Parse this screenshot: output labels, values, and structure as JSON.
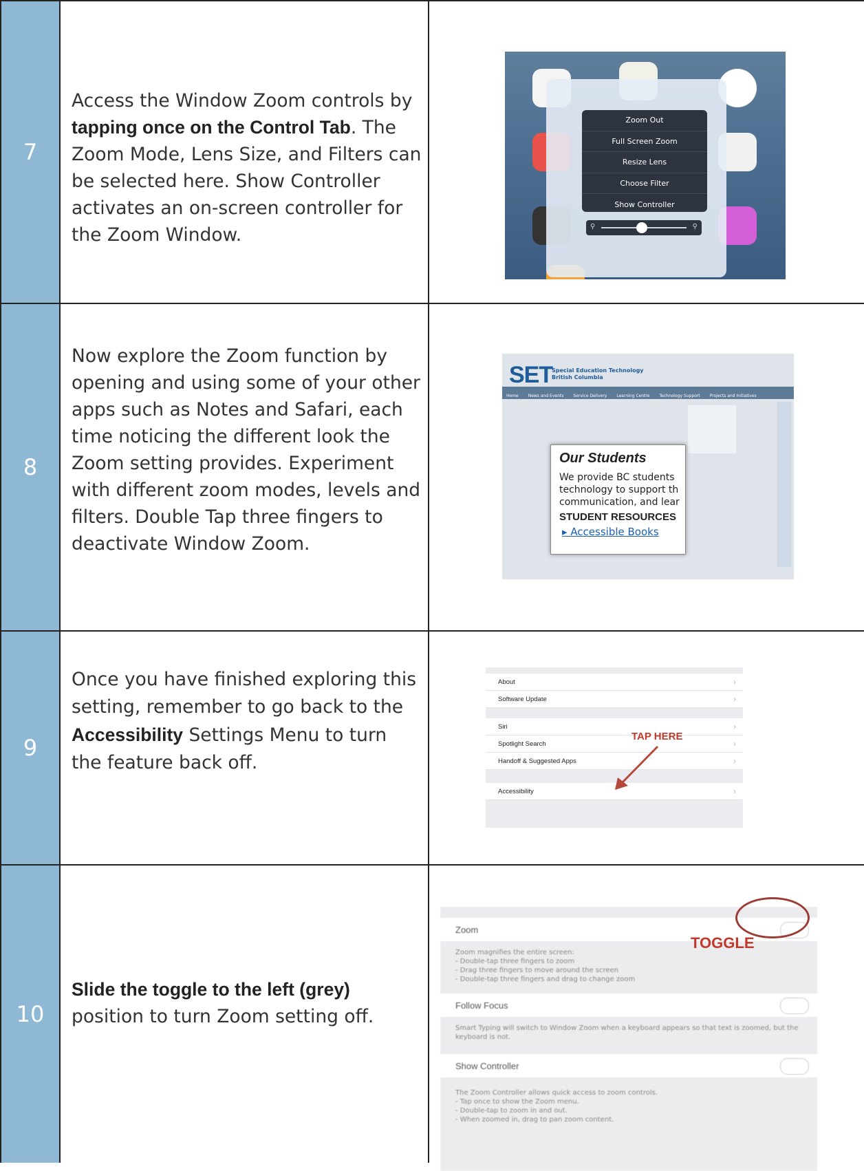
{
  "rows": [
    {
      "num": "7",
      "pre": "Access the Window Zoom controls by ",
      "bold": "tapping once on the Control Tab",
      "post": ". The Zoom Mode, Lens Size, and Filters can be selected here. Show Controller activates an on-screen controller for the Zoom Window."
    },
    {
      "num": "8",
      "text": "Now explore the Zoom function by opening and using some of your other apps such as Notes and Safari, each time noticing the different look the Zoom setting provides. Experiment with different zoom modes, levels and filters. Double Tap three fingers to deactivate Window Zoom."
    },
    {
      "num": "9",
      "pre": "Once you have finished exploring this setting, remember to go back to the ",
      "bold": "Accessibility",
      "post": " Settings Menu to turn the feature back off."
    },
    {
      "num": "10",
      "bold": "Slide the toggle to the left (grey)",
      "post": " position to turn Zoom setting off."
    }
  ],
  "img7": {
    "menu": [
      "Zoom Out",
      "Full Screen Zoom",
      "Resize Lens",
      "Choose Filter",
      "Show Controller"
    ]
  },
  "img8": {
    "logo": "SET",
    "logo_sub1": "Special Education Technology",
    "logo_sub2": "British Columbia",
    "nav": [
      "Home",
      "News and Events",
      "Service Delivery",
      "Learning Centre",
      "Technology Support",
      "Projects and Initiatives"
    ],
    "lens_title": "Our Students",
    "lens_lines": [
      "We provide BC students",
      "technology to support th",
      "communication, and lear"
    ],
    "lens_head": "STUDENT RESOURCES",
    "lens_link": "Accessible Books"
  },
  "img9": {
    "group1": [
      "About",
      "Software Update"
    ],
    "group2": [
      "Siri",
      "Spotlight Search",
      "Handoff & Suggested Apps"
    ],
    "group3": [
      "Accessibility"
    ],
    "tap_label": "TAP HERE"
  },
  "img10": {
    "zoom": "Zoom",
    "zoom_desc": [
      "Zoom magnifies the entire screen:",
      "- Double-tap three fingers to zoom",
      "- Drag three fingers to move around the screen",
      "- Double-tap three fingers and drag to change zoom"
    ],
    "follow": "Follow Focus",
    "follow_desc": "Smart Typing will switch to Window Zoom when a keyboard appears so that text is zoomed, but the keyboard is not.",
    "show": "Show Controller",
    "show_desc": [
      "The Zoom Controller allows quick access to zoom controls.",
      "- Tap once to show the Zoom menu.",
      "- Double-tap to zoom in and out.",
      "- When zoomed in, drag to pan zoom content."
    ],
    "toggle_label": "TOGGLE"
  }
}
